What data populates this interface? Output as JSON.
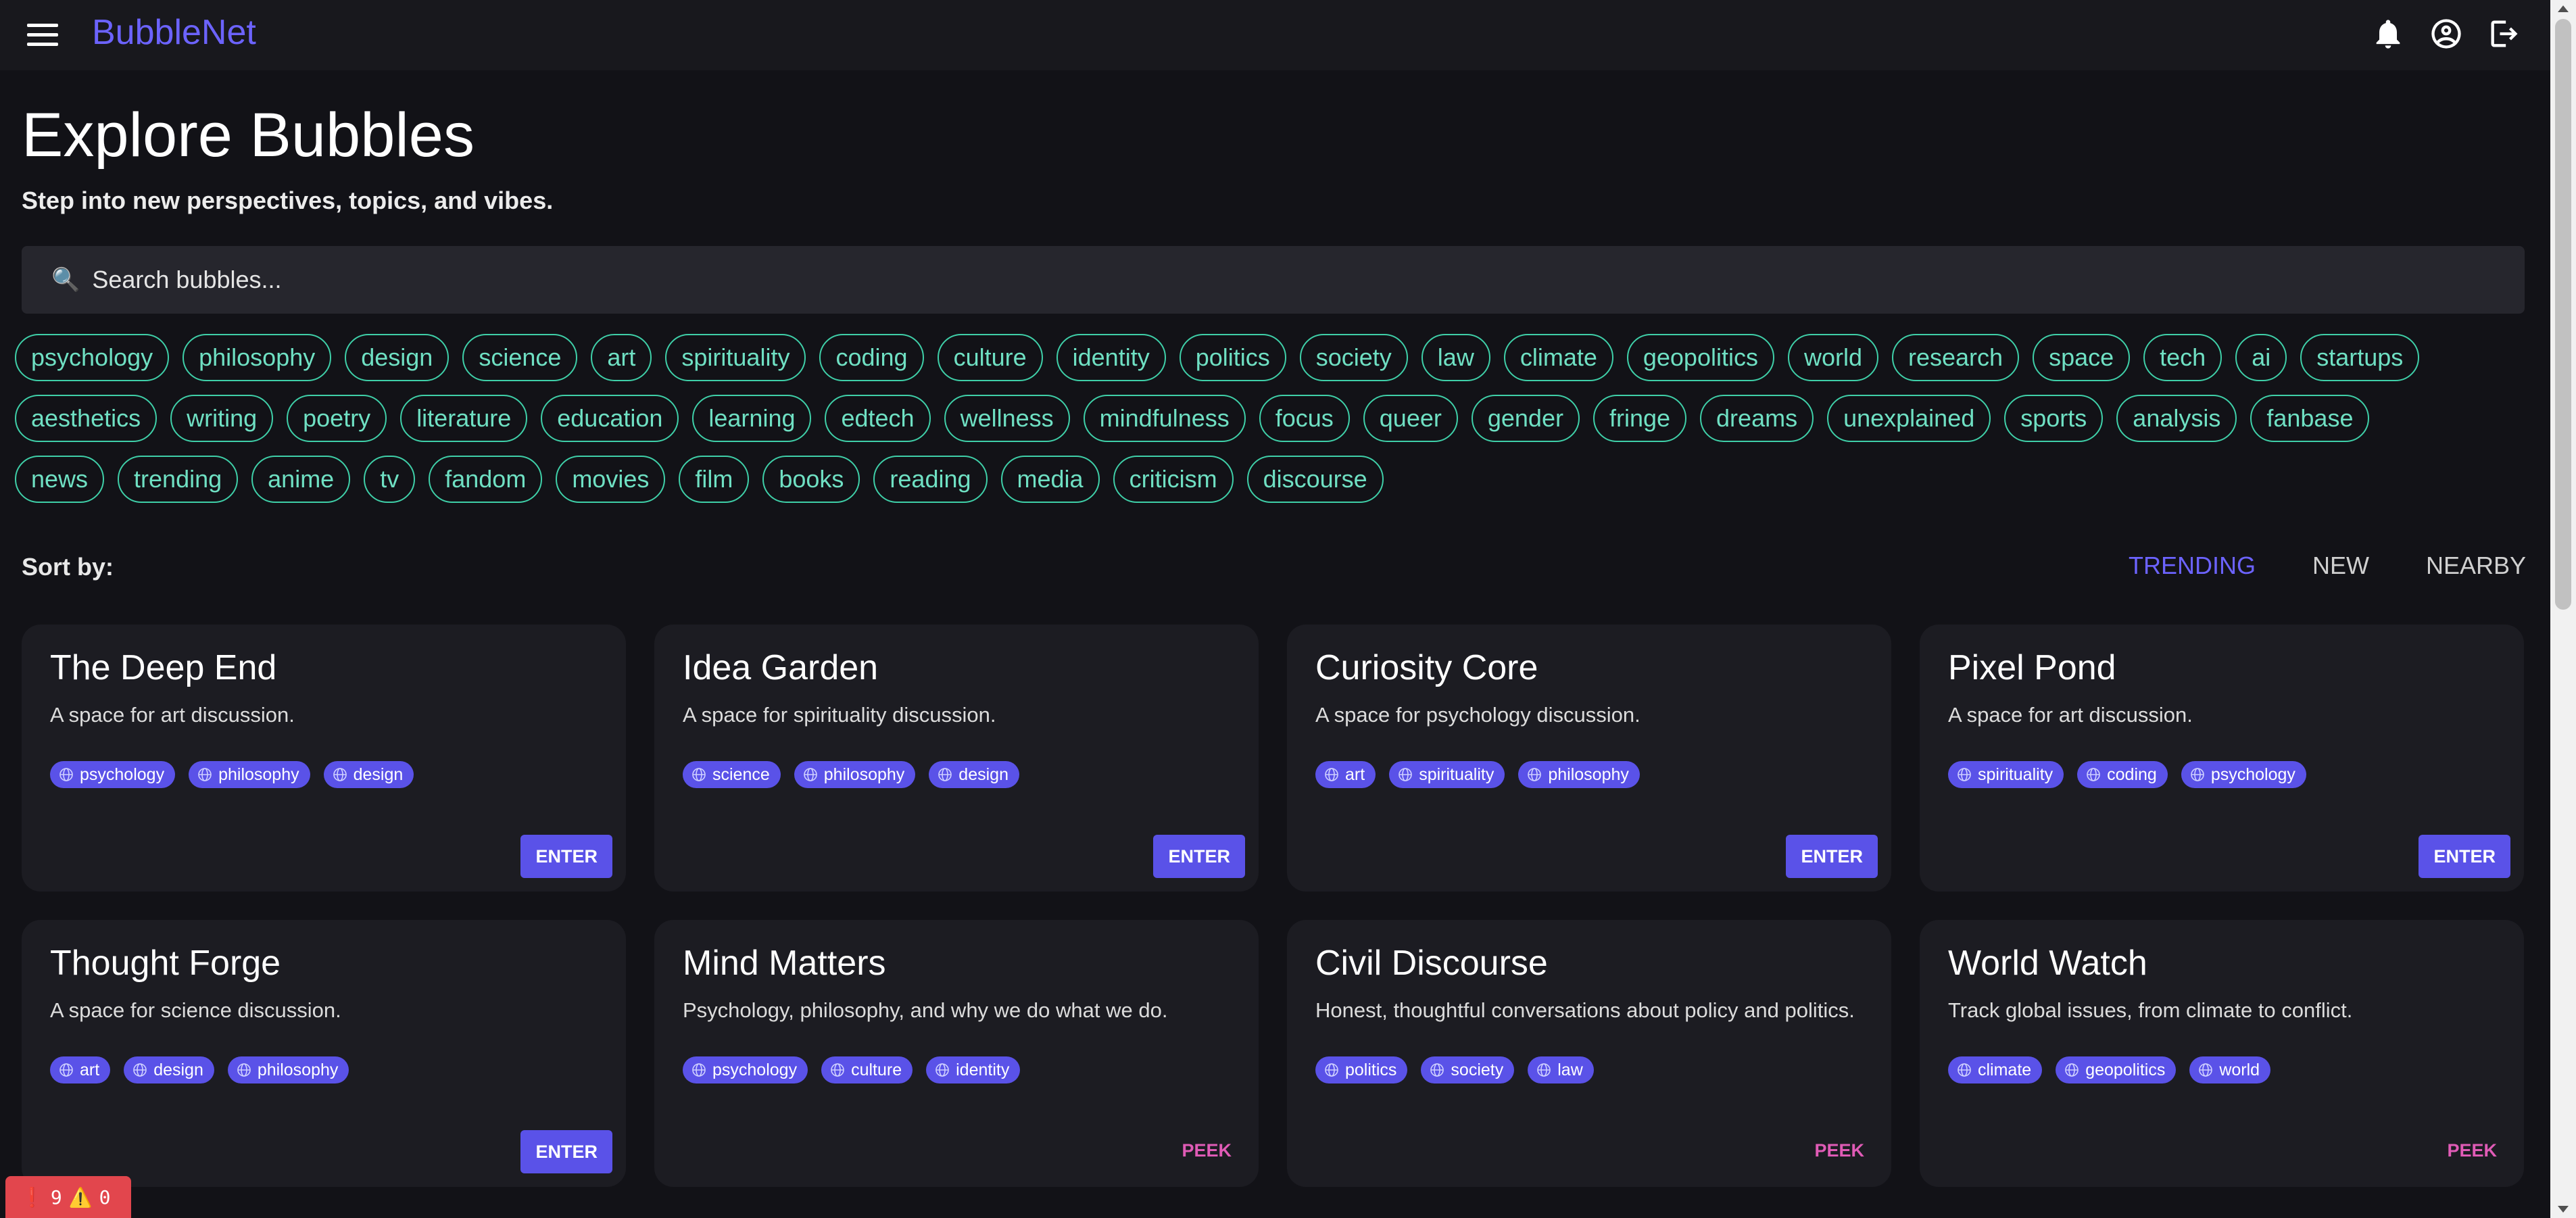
{
  "app": {
    "brand": "BubbleNet",
    "icons": [
      "menu-icon",
      "bell-icon",
      "account-icon",
      "logout-icon"
    ]
  },
  "header": {
    "title": "Explore Bubbles",
    "subtitle": "Step into new perspectives, topics, and vibes."
  },
  "search": {
    "icon": "🔍",
    "placeholder": "Search bubbles..."
  },
  "tags": [
    [
      "psychology",
      "philosophy",
      "design",
      "science",
      "art",
      "spirituality",
      "coding",
      "culture",
      "identity",
      "politics",
      "society",
      "law",
      "climate",
      "geopolitics",
      "world",
      "research",
      "space",
      "tech",
      "ai",
      "startups"
    ],
    [
      "aesthetics",
      "writing",
      "poetry",
      "literature",
      "education",
      "learning",
      "edtech",
      "wellness",
      "mindfulness",
      "focus",
      "queer",
      "gender",
      "fringe",
      "dreams",
      "unexplained",
      "sports",
      "analysis",
      "fanbase"
    ],
    [
      "news",
      "trending",
      "anime",
      "tv",
      "fandom",
      "movies",
      "film",
      "books",
      "reading",
      "media",
      "criticism",
      "discourse"
    ]
  ],
  "sort": {
    "label": "Sort by:",
    "options": [
      "TRENDING",
      "NEW",
      "NEARBY"
    ],
    "active": "TRENDING"
  },
  "cards": [
    {
      "title": "The Deep End",
      "description": "A space for art discussion.",
      "tags": [
        "psychology",
        "philosophy",
        "design"
      ],
      "action": "ENTER"
    },
    {
      "title": "Idea Garden",
      "description": "A space for spirituality discussion.",
      "tags": [
        "science",
        "philosophy",
        "design"
      ],
      "action": "ENTER"
    },
    {
      "title": "Curiosity Core",
      "description": "A space for psychology discussion.",
      "tags": [
        "art",
        "spirituality",
        "philosophy"
      ],
      "action": "ENTER"
    },
    {
      "title": "Pixel Pond",
      "description": "A space for art discussion.",
      "tags": [
        "spirituality",
        "coding",
        "psychology"
      ],
      "action": "ENTER"
    },
    {
      "title": "Thought Forge",
      "description": "A space for science discussion.",
      "tags": [
        "art",
        "design",
        "philosophy"
      ],
      "action": "ENTER"
    },
    {
      "title": "Mind Matters",
      "description": "Psychology, philosophy, and why we do what we do.",
      "tags": [
        "psychology",
        "culture",
        "identity"
      ],
      "action": "PEEK"
    },
    {
      "title": "Civil Discourse",
      "description": "Honest, thoughtful conversations about policy and politics.",
      "tags": [
        "politics",
        "society",
        "law"
      ],
      "action": "PEEK"
    },
    {
      "title": "World Watch",
      "description": "Track global issues, from climate to conflict.",
      "tags": [
        "climate",
        "geopolitics",
        "world"
      ],
      "action": "PEEK"
    }
  ],
  "error_badge": {
    "errors": "9",
    "warnings": "0",
    "error_icon": "❗",
    "warning_icon": "⚠️"
  },
  "colors": {
    "background": "#121217",
    "accent": "#5a52e8",
    "brand": "#6c63ff",
    "chip": "#3fcfa8",
    "peek": "#e05bb6"
  }
}
